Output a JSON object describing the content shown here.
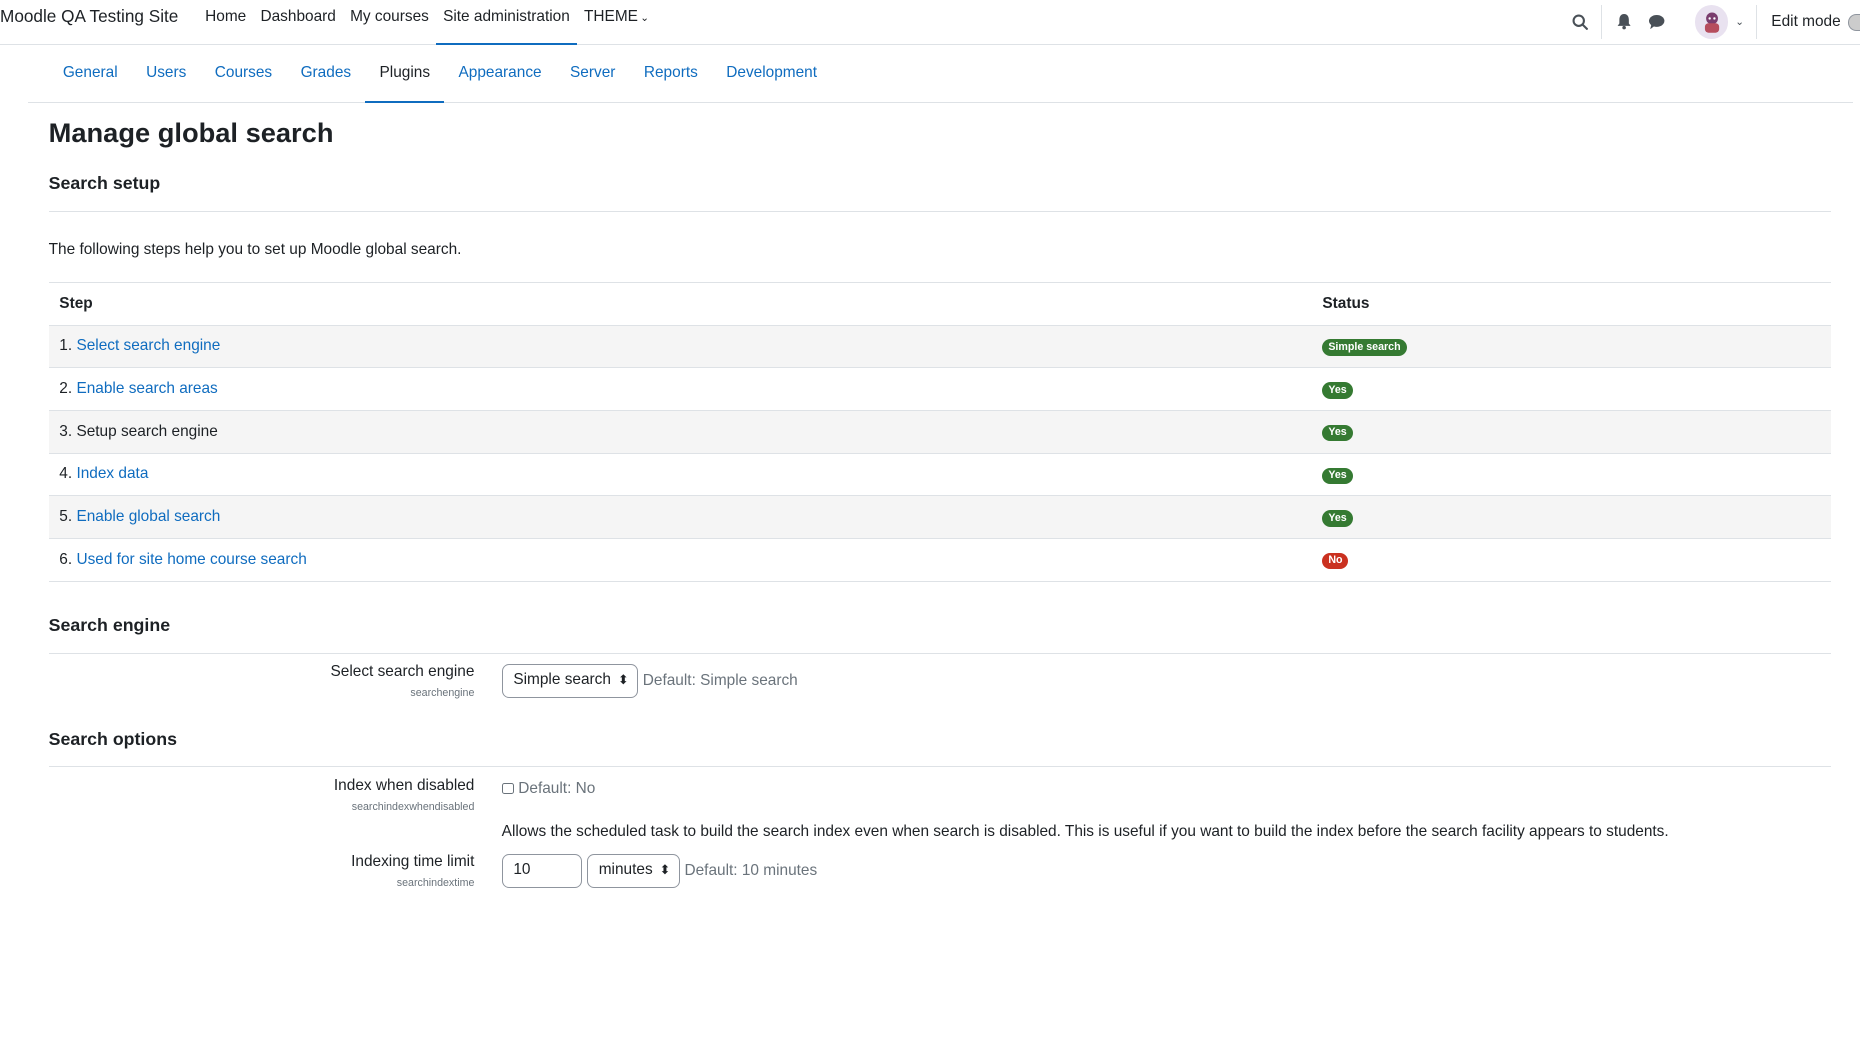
{
  "navbar": {
    "site_name": "Moodle QA Testing Site",
    "items": [
      {
        "label": "Home"
      },
      {
        "label": "Dashboard"
      },
      {
        "label": "My courses"
      },
      {
        "label": "Site administration"
      },
      {
        "label": "THEME"
      }
    ],
    "edit_mode_label": "Edit mode"
  },
  "secondary_nav": {
    "tabs": [
      {
        "label": "General"
      },
      {
        "label": "Users"
      },
      {
        "label": "Courses"
      },
      {
        "label": "Grades"
      },
      {
        "label": "Plugins"
      },
      {
        "label": "Appearance"
      },
      {
        "label": "Server"
      },
      {
        "label": "Reports"
      },
      {
        "label": "Development"
      }
    ]
  },
  "page": {
    "title": "Manage global search",
    "setup_heading": "Search setup",
    "intro": "The following steps help you to set up Moodle global search.",
    "table": {
      "headers": {
        "step": "Step",
        "status": "Status"
      },
      "rows": [
        {
          "num": "1.",
          "label": "Select search engine",
          "status": "Simple search"
        },
        {
          "num": "2.",
          "label": "Enable search areas",
          "status": "Yes"
        },
        {
          "num": "3.",
          "label": "Setup search engine",
          "status": "Yes"
        },
        {
          "num": "4.",
          "label": "Index data",
          "status": "Yes"
        },
        {
          "num": "5.",
          "label": "Enable global search",
          "status": "Yes"
        },
        {
          "num": "6.",
          "label": "Used for site home course search",
          "status": "No"
        }
      ]
    },
    "engine_heading": "Search engine",
    "engine_setting": {
      "label": "Select search engine",
      "key": "searchengine",
      "value": "Simple search",
      "default": "Default: Simple search"
    },
    "options_heading": "Search options",
    "index_disabled": {
      "label": "Index when disabled",
      "key": "searchindexwhendisabled",
      "default": "Default: No",
      "description": "Allows the scheduled task to build the search index even when search is disabled. This is useful if you want to build the index before the search facility appears to students."
    },
    "time_limit": {
      "label": "Indexing time limit",
      "key": "searchindextime",
      "value": "10",
      "unit": "minutes",
      "default": "Default: 10 minutes"
    }
  },
  "colors": {
    "link": "#0f6cbf",
    "success": "#357a32",
    "danger": "#ca3120"
  }
}
